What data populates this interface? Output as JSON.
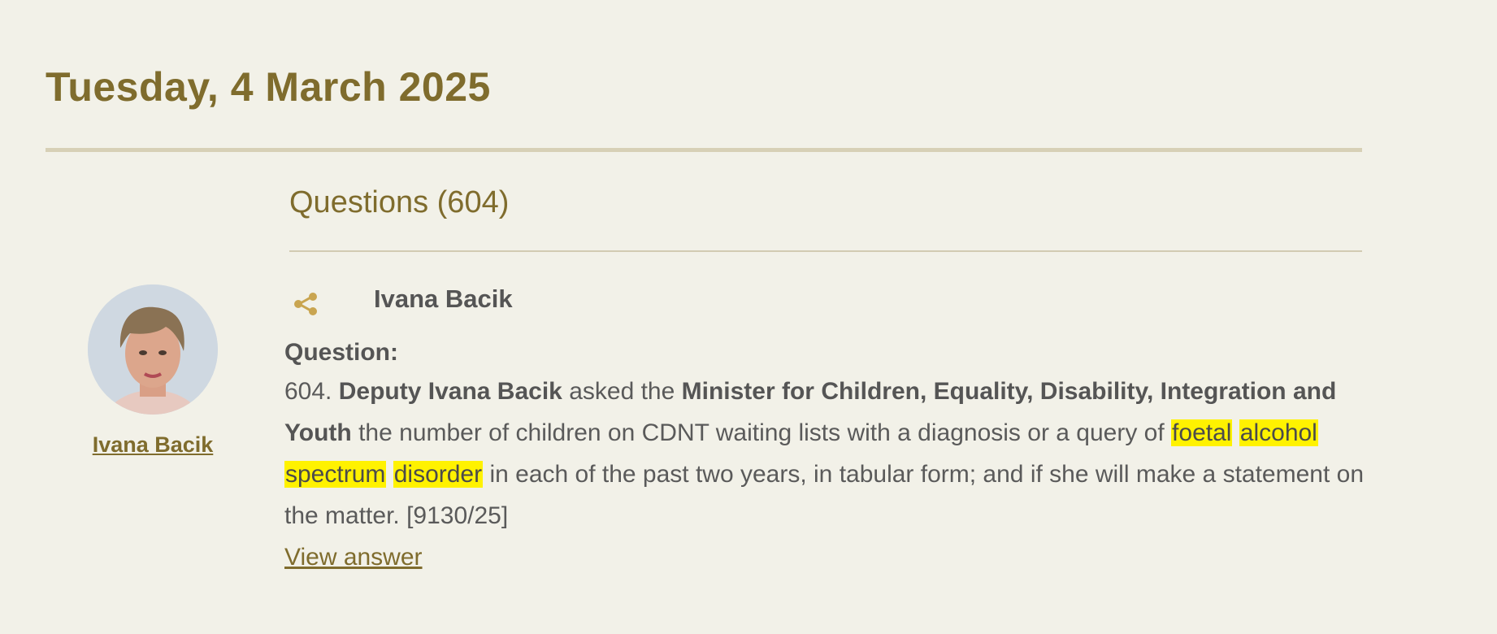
{
  "page": {
    "date_heading": "Tuesday, 4 March 2025",
    "section_title": "Questions (604)"
  },
  "member": {
    "name": "Ivana Bacik",
    "link_label": "Ivana Bacik"
  },
  "question": {
    "label": "Question:",
    "number": "604.",
    "deputy": "Deputy Ivana Bacik",
    "asked_the": "asked the",
    "minister": "Minister for Children, Equality, Disability, Integration and Youth",
    "text_part1": "the number of children on CDNT waiting lists with a diagnosis or a query of",
    "highlight_terms": [
      "foetal",
      "alcohol",
      "spectrum",
      "disorder"
    ],
    "text_part2": "in each of the past two years, in tabular form; and if she will make a statement on the matter. [9130/25]",
    "view_answer_label": "View answer"
  },
  "colors": {
    "background": "#f2f1e8",
    "accent": "#7f6c2d",
    "text": "#5a5a5a",
    "highlight": "#fff200",
    "share_icon": "#c9a550"
  },
  "icons": {
    "share": "share-icon"
  }
}
